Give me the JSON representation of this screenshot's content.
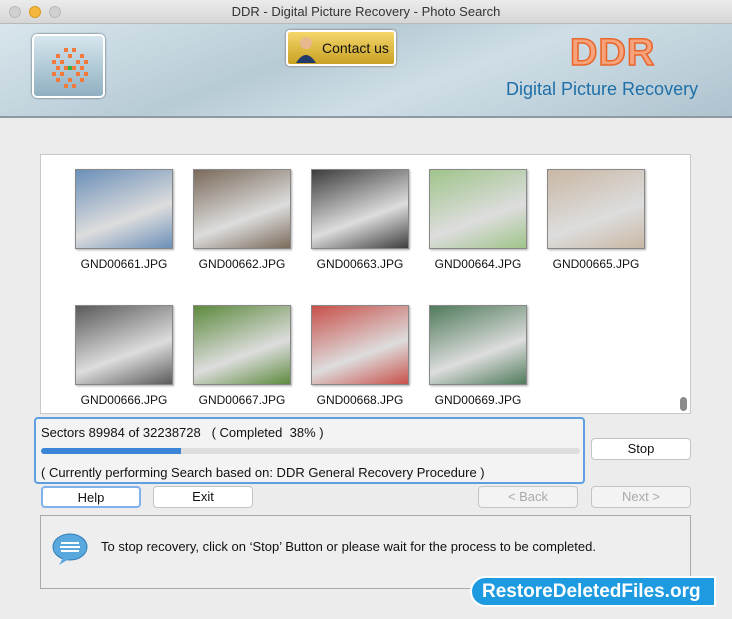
{
  "window": {
    "title": "DDR - Digital Picture Recovery - Photo Search"
  },
  "header": {
    "contact_label": "Contact us",
    "brand": "DDR",
    "subtitle": "Digital Picture Recovery"
  },
  "gallery": {
    "items": [
      {
        "name": "GND00661.JPG"
      },
      {
        "name": "GND00662.JPG"
      },
      {
        "name": "GND00663.JPG"
      },
      {
        "name": "GND00664.JPG"
      },
      {
        "name": "GND00665.JPG"
      },
      {
        "name": "GND00666.JPG"
      },
      {
        "name": "GND00667.JPG"
      },
      {
        "name": "GND00668.JPG"
      },
      {
        "name": "GND00669.JPG"
      }
    ]
  },
  "progress": {
    "sectors_text": "Sectors 89984 of 32238728   ( Completed  38% )",
    "bar_fill_fraction": 0.26,
    "current_text": "( Currently performing Search based on: DDR General Recovery Procedure )",
    "color": "#3a85d8"
  },
  "buttons": {
    "stop": "Stop",
    "help": "Help",
    "exit": "Exit",
    "back": "< Back",
    "next": "Next >"
  },
  "info": {
    "message": "To stop recovery, click on ‘Stop’ Button or please wait for the process to be completed."
  },
  "watermark": "RestoreDeletedFiles.org"
}
